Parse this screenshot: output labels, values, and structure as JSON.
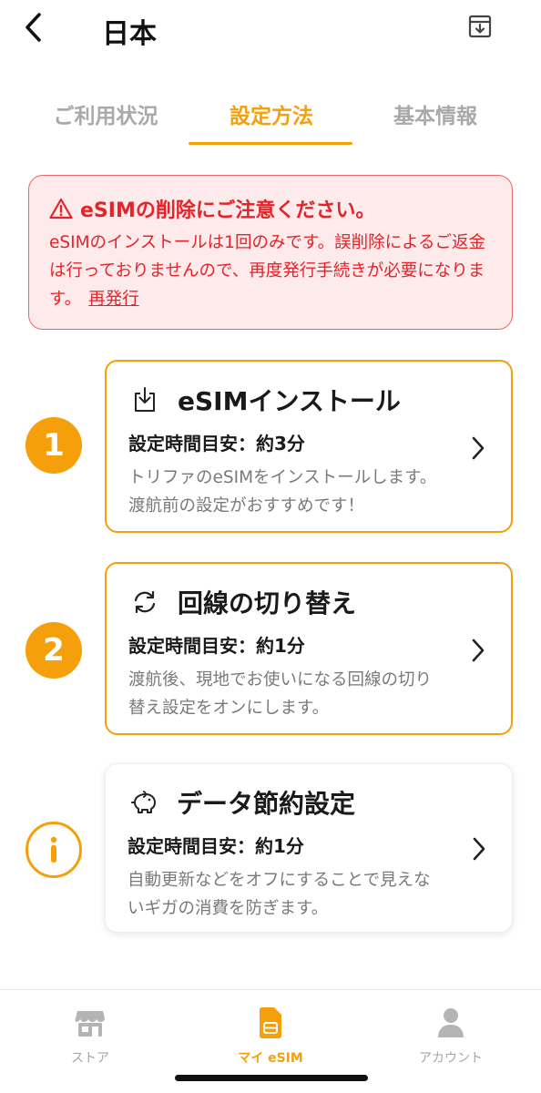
{
  "header": {
    "title": "日本"
  },
  "tabs": [
    {
      "label": "ご利用状況",
      "active": false
    },
    {
      "label": "設定方法",
      "active": true
    },
    {
      "label": "基本情報",
      "active": false
    }
  ],
  "warning": {
    "title": "eSIMの削除にご注意ください。",
    "body": "eSIMのインストールは1回のみです。誤削除によるご返金は行っておりませんので、再度発行手続きが必要になります。",
    "link": "再発行"
  },
  "steps": [
    {
      "badge": "1",
      "icon": "install-icon",
      "title": "eSIMインストール",
      "time": "設定時間目安：約3分",
      "desc": "トリファのeSIMをインストールします。渡航前の設定がおすすめです！"
    },
    {
      "badge": "2",
      "icon": "switch-line-icon",
      "title": "回線の切り替え",
      "time": "設定時間目安：約1分",
      "desc": "渡航後、現地でお使いになる回線の切り替え設定をオンにします。"
    },
    {
      "badge": "i",
      "icon": "piggy-bank-icon",
      "title": "データ節約設定",
      "time": "設定時間目安：約1分",
      "desc": "自動更新などをオフにすることで見えないギガの消費を防ぎます。"
    }
  ],
  "bottom_nav": [
    {
      "label": "ストア",
      "icon": "store-icon",
      "active": false
    },
    {
      "label": "マイ eSIM",
      "icon": "sim-card-icon",
      "active": true
    },
    {
      "label": "アカウント",
      "icon": "person-icon",
      "active": false
    }
  ],
  "colors": {
    "accent": "#f5a00a",
    "warning_text": "#e3242b",
    "warning_bg": "#fdeaea",
    "inactive": "#a9a9a9"
  }
}
